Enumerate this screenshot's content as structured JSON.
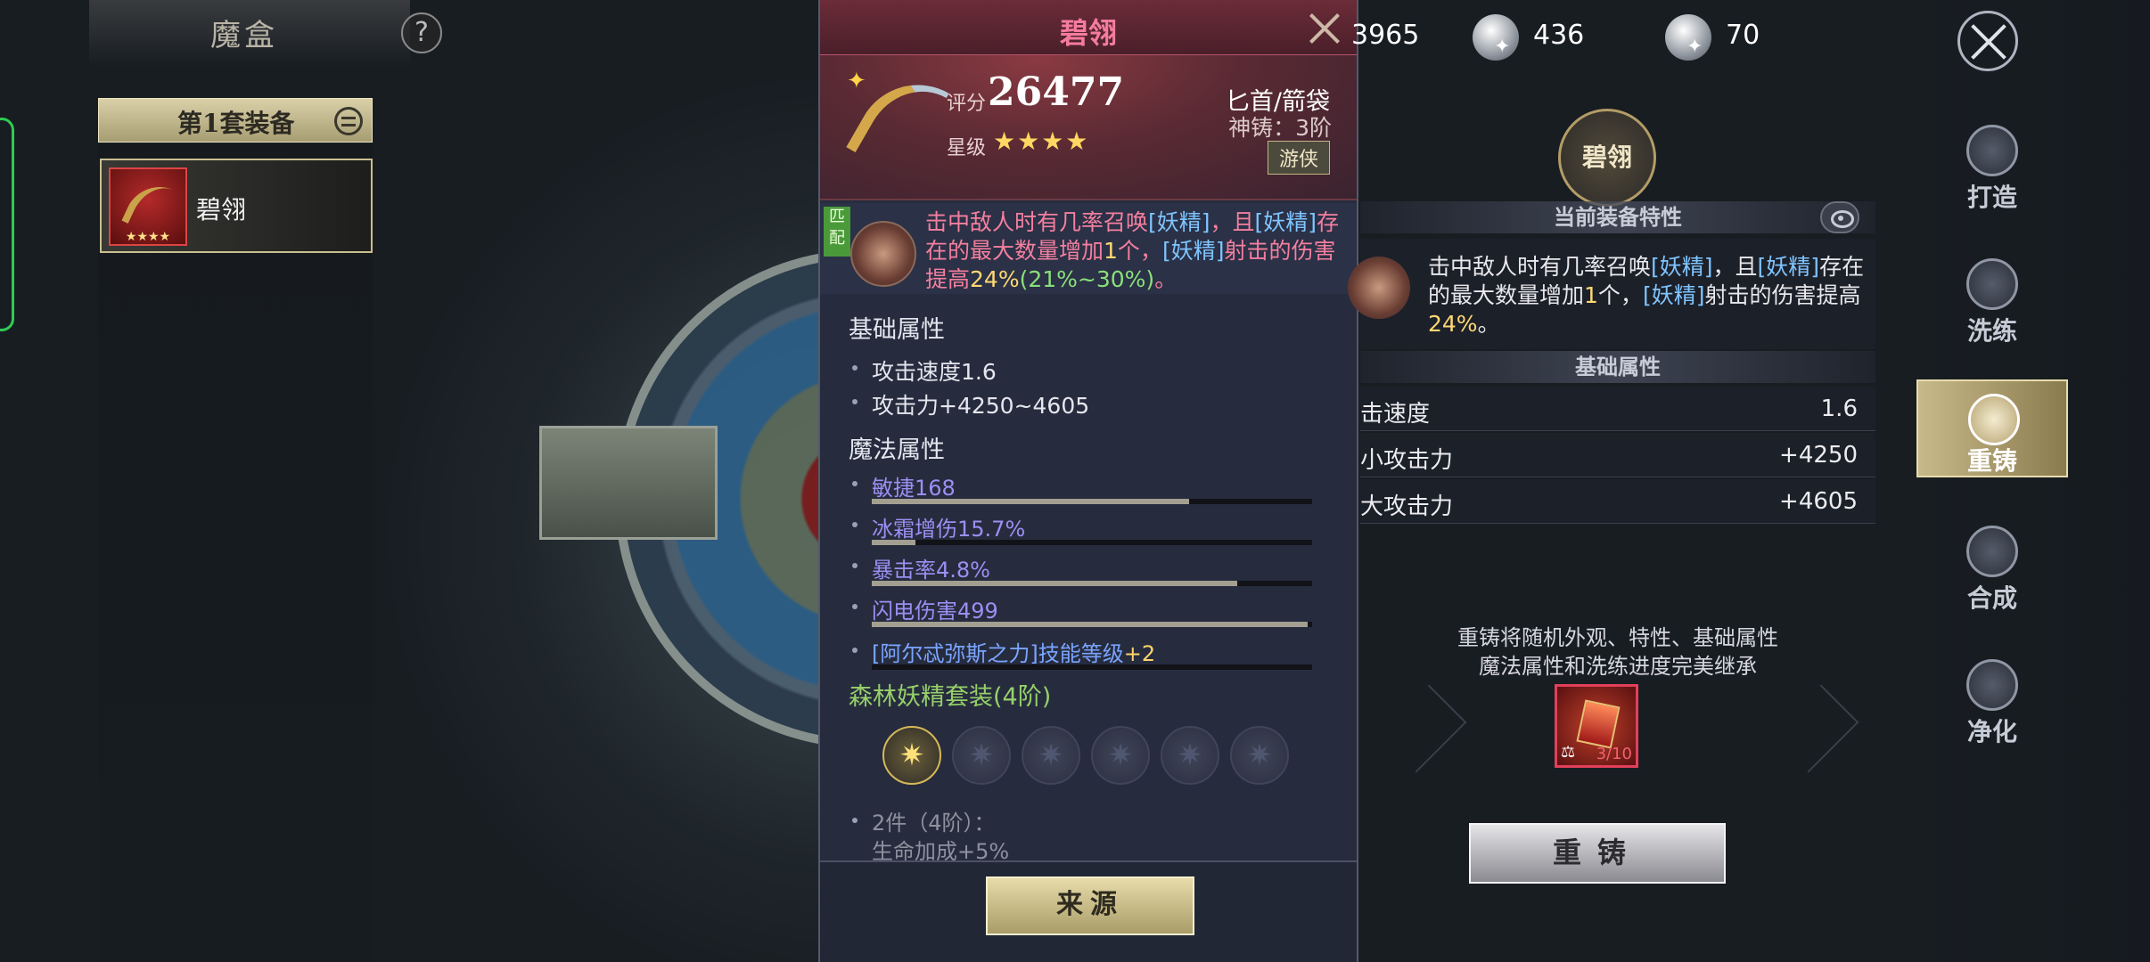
{
  "left": {
    "title": "魔盒",
    "help_icon": "?",
    "set_label": "第1套装备",
    "item": {
      "name": "碧翎",
      "stars": "★★★★"
    }
  },
  "card": {
    "title": "碧翎",
    "score_label": "评分",
    "score": "26477",
    "stars_label": "星级",
    "stars": "★★★★",
    "type": "匕首/箭袋",
    "forge": "神铸：3阶",
    "tag": "游侠",
    "match_badge": "匹配",
    "trait": {
      "p1": "击中敌人时有几率召唤",
      "h1": "[妖精]",
      "p2": "，且",
      "h2": "[妖精]",
      "p3": "存在的最大数量增加",
      "n1": "1",
      "p4": "个，",
      "h3": "[妖精]",
      "p5": "射击的伤害提高",
      "n2": "24%",
      "ex": "(21%~30%)",
      "end": "。"
    },
    "base_title": "基础属性",
    "base_stats": [
      "攻击速度1.6",
      "攻击力+4250~4605"
    ],
    "magic_title": "魔法属性",
    "magic": [
      {
        "label": "敏捷",
        "value": "168",
        "fill": 0.72
      },
      {
        "label": "冰霜增伤",
        "value": "15.7%",
        "fill": 0.1
      },
      {
        "label": "暴击率",
        "value": "4.8%",
        "fill": 0.83
      },
      {
        "label": "闪电伤害",
        "value": "499",
        "fill": 0.99
      },
      {
        "label": "[阿尔忒弥斯之力]技能等级",
        "value": "+2",
        "fill": 0.0
      }
    ],
    "set_name": "森林妖精套装(4阶)",
    "set_bonus_title": "2件（4阶）：",
    "set_bonus_effect": "生命加成+5%",
    "source_button": "来源"
  },
  "currency": {
    "c1": "3965",
    "c2": "436",
    "c3": "70"
  },
  "right": {
    "emblem": "碧翎",
    "trait_title": "当前装备特性",
    "trait": {
      "p1": "击中敌人时有几率召唤",
      "h1": "[妖精]",
      "p2": "，且",
      "h2": "[妖精]",
      "p3": "存在的最大数量增加",
      "n1": "1",
      "p4": "个，",
      "h3": "[妖精]",
      "p5": "射击的伤害提高",
      "n2": "24%",
      "end": "。"
    },
    "base_title": "基础属性",
    "rows": [
      {
        "k": "击速度",
        "v": "1.6"
      },
      {
        "k": "小攻击力",
        "v": "+4250"
      },
      {
        "k": "大攻击力",
        "v": "+4605"
      }
    ],
    "note_line1": "重铸将随机外观、特性、基础属性",
    "note_line2": "魔法属性和洗练进度完美继承",
    "material_count": "3/10",
    "recast_button": "重铸"
  },
  "nav": [
    {
      "label": "打造",
      "icon": "forge-icon"
    },
    {
      "label": "洗练",
      "icon": "refine-icon"
    },
    {
      "label": "重铸",
      "icon": "recast-icon",
      "active": true
    },
    {
      "label": "合成",
      "icon": "combine-icon"
    },
    {
      "label": "净化",
      "icon": "purify-icon"
    }
  ]
}
